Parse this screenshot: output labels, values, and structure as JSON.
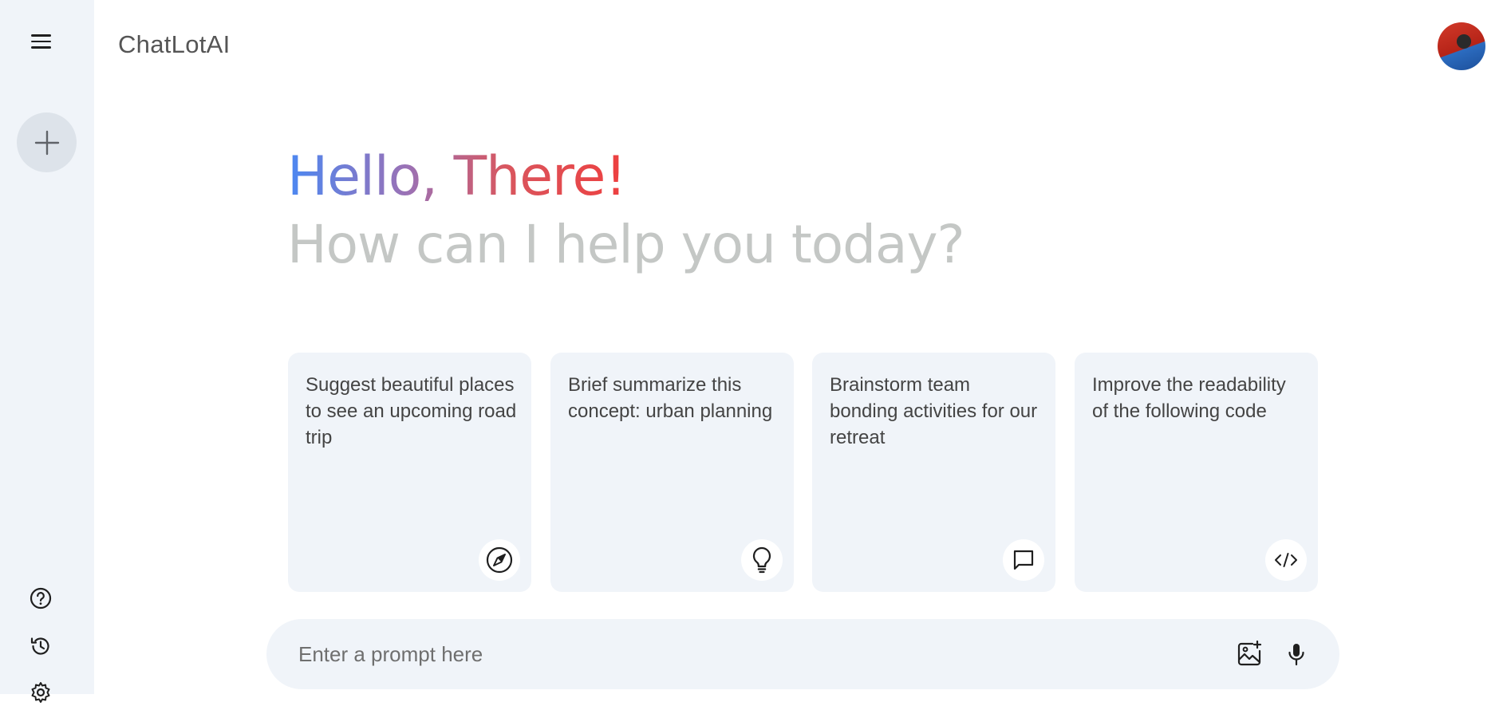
{
  "app": {
    "brand": "ChatLotAI"
  },
  "sidebar": {
    "menu_icon": "hamburger-menu-icon",
    "new_chat_icon": "plus-icon",
    "bottom_icons": [
      "help-icon",
      "history-icon",
      "settings-icon"
    ]
  },
  "greeting": {
    "hello": "Hello, There!",
    "subtitle": "How can I help you today?"
  },
  "cards": [
    {
      "text": "Suggest beautiful places to see an upcoming road trip",
      "icon": "compass-icon"
    },
    {
      "text": "Brief summarize this concept: urban planning",
      "icon": "lightbulb-icon"
    },
    {
      "text": "Brainstorm team bonding activities for our retreat",
      "icon": "message-icon"
    },
    {
      "text": "Improve the readability of the following code",
      "icon": "code-icon"
    }
  ],
  "prompt": {
    "placeholder": "Enter a prompt here",
    "value": "",
    "icons": [
      "add-image-icon",
      "microphone-icon"
    ]
  },
  "colors": {
    "sidebar_bg": "#f0f4f9",
    "card_bg": "#f0f4f9",
    "greeting_gradient": [
      "#4b88f2",
      "#9a72b6",
      "#d9565e",
      "#ee3f3f"
    ],
    "subtitle": "#c4c7c5"
  }
}
